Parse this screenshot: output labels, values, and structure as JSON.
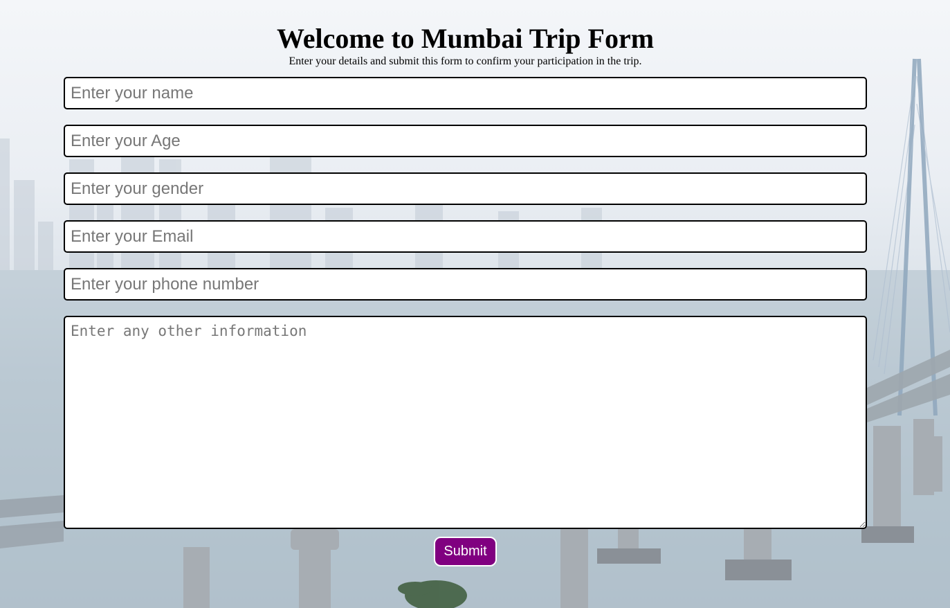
{
  "header": {
    "title": "Welcome to Mumbai Trip Form",
    "subtitle": "Enter your details and submit this form to confirm your participation in the trip."
  },
  "form": {
    "name_placeholder": "Enter your name",
    "age_placeholder": "Enter your Age",
    "gender_placeholder": "Enter your gender",
    "email_placeholder": "Enter your Email",
    "phone_placeholder": "Enter your phone number",
    "info_placeholder": "Enter any other information",
    "submit_label": "Submit"
  },
  "colors": {
    "submit_bg": "#800080",
    "field_border": "#000000"
  }
}
